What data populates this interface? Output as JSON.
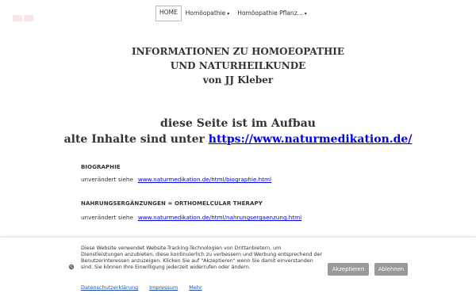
{
  "nav": {
    "items": [
      {
        "label": "HOME",
        "caret": ""
      },
      {
        "label": "Homöopathie",
        "caret": "▾"
      },
      {
        "label": "Homöopathie Pflanz...",
        "caret": "▾"
      }
    ]
  },
  "header": {
    "line1": "INFORMATIONEN  ZU  HOMOEOPATHIE",
    "line2": "UND NATURHEILKUNDE",
    "line3": "von JJ Kleber"
  },
  "notice": {
    "line1": "diese Seite ist im Aufbau",
    "line2_prefix": "alte Inhalte sind unter ",
    "line2_link": "https://www.naturmedikation.de/"
  },
  "sections": [
    {
      "title": "BIOGRAPHIE",
      "prefix": "unverändert  siehe",
      "link": "www.naturmedikation.de/html/biographie.html"
    },
    {
      "title": "NAHRUNGSERGÄNZUNGEN = ORTHOMELCULAR THERAPY",
      "prefix": "unverändert siehe",
      "link": "www.naturmedikation.de/html/nahrungsergaenzung.html"
    }
  ],
  "cookie": {
    "icon": "cookie-icon",
    "text": "Diese Website verwendet Website-Tracking-Technologien von Drittanbietern, um Dienstleistungen anzubieten, diese kontinuierlich zu verbessern und Werbung entsprechend der Benutzerinteressen anzuzeigen. Klicken Sie auf \"Akzeptieren\" wenn Sie damit einverstanden sind. Sie können Ihre Einwilligung jederzeit widerrufen oder ändern.",
    "links": [
      "Datenschutzerklärung",
      "Impressum",
      "Mehr"
    ],
    "accept_label": "Akzeptieren",
    "reject_label": "Ablehnen"
  }
}
